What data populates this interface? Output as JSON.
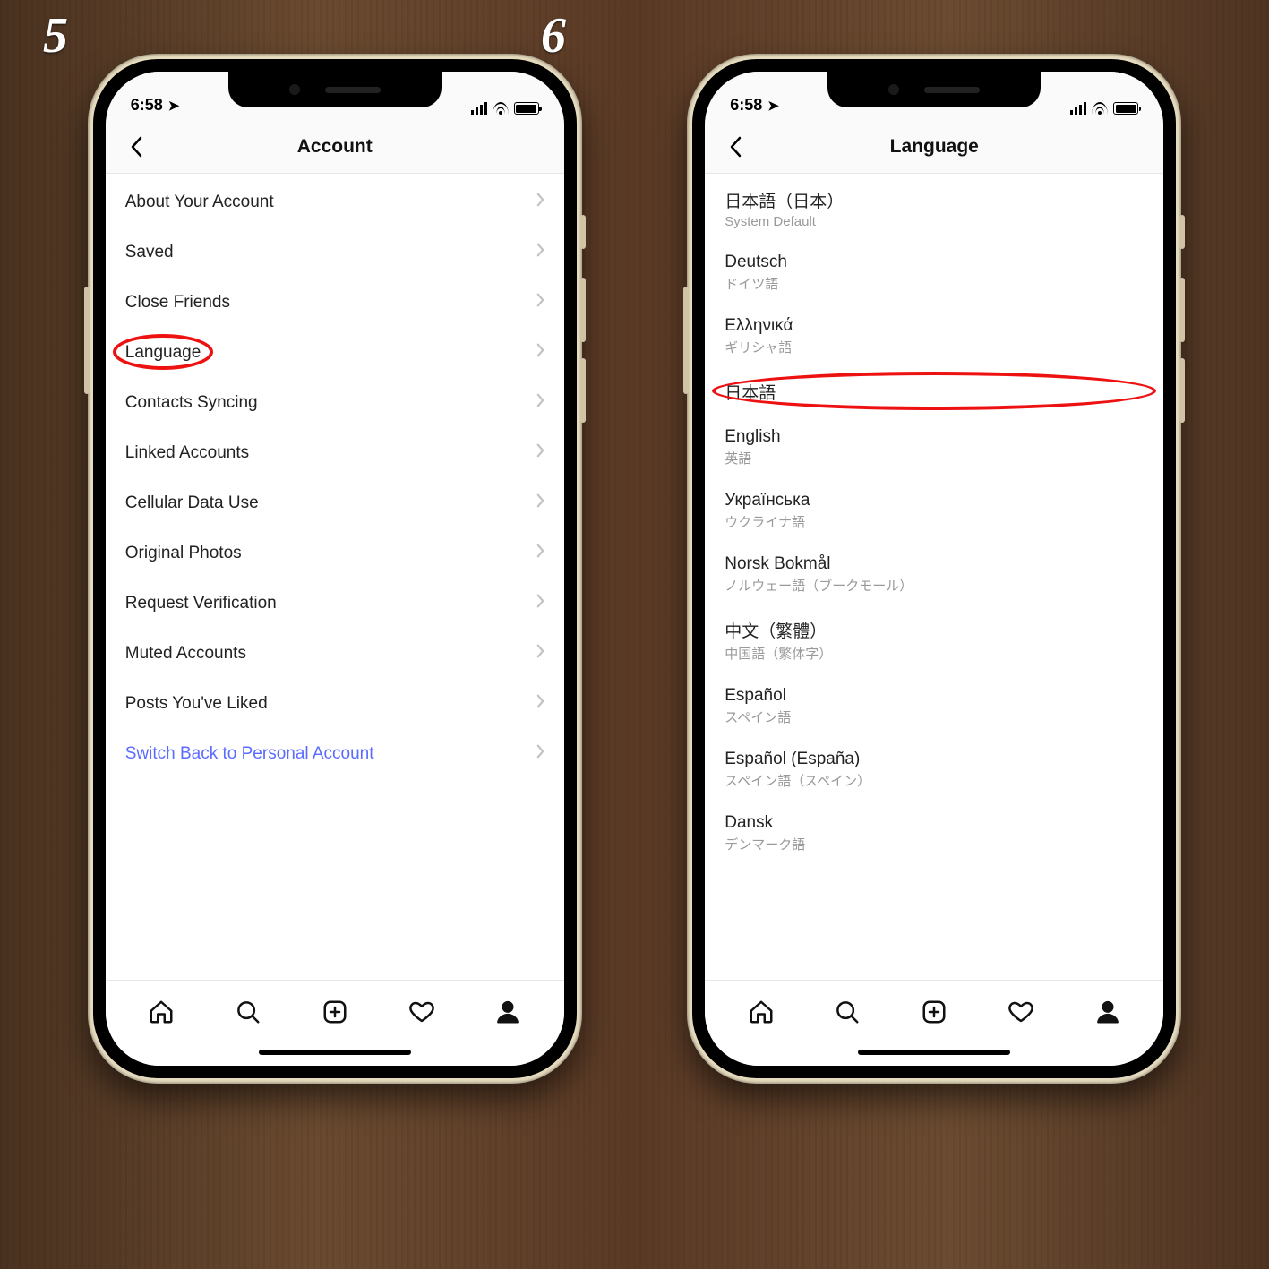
{
  "steps": {
    "left": "5",
    "right": "6"
  },
  "status": {
    "time": "6:58"
  },
  "left": {
    "title": "Account",
    "items": [
      {
        "label": "About Your Account"
      },
      {
        "label": "Saved"
      },
      {
        "label": "Close Friends"
      },
      {
        "label": "Language"
      },
      {
        "label": "Contacts Syncing"
      },
      {
        "label": "Linked Accounts"
      },
      {
        "label": "Cellular Data Use"
      },
      {
        "label": "Original Photos"
      },
      {
        "label": "Request Verification"
      },
      {
        "label": "Muted Accounts"
      },
      {
        "label": "Posts You've Liked"
      }
    ],
    "link_label": "Switch Back to Personal Account",
    "highlighted_index": 3
  },
  "right": {
    "title": "Language",
    "items": [
      {
        "primary": "日本語（日本）",
        "secondary": "System Default"
      },
      {
        "primary": "Deutsch",
        "secondary": "ドイツ語"
      },
      {
        "primary": "Ελληνικά",
        "secondary": "ギリシャ語"
      },
      {
        "primary": "日本語",
        "secondary": ""
      },
      {
        "primary": "English",
        "secondary": "英語"
      },
      {
        "primary": "Українська",
        "secondary": "ウクライナ語"
      },
      {
        "primary": "Norsk Bokmål",
        "secondary": "ノルウェー語（ブークモール）"
      },
      {
        "primary": "中文（繁體）",
        "secondary": "中国語（繁体字）"
      },
      {
        "primary": "Español",
        "secondary": "スペイン語"
      },
      {
        "primary": "Español (España)",
        "secondary": "スペイン語（スペイン）"
      },
      {
        "primary": "Dansk",
        "secondary": "デンマーク語"
      }
    ],
    "highlighted_index": 3
  }
}
